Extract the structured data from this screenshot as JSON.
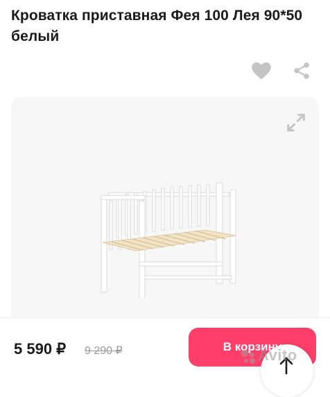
{
  "product": {
    "title": "Кроватка приставная Фея 100 Лея 90*50 белый"
  },
  "actions": {
    "favorite_icon": "heart-icon",
    "share_icon": "share-icon",
    "expand_icon": "expand-icon"
  },
  "purchase": {
    "price": "5 590 ₽",
    "old_price": "9 290 ₽",
    "cart_label": "В корзину"
  },
  "watermark": {
    "text": "Avito"
  },
  "colors": {
    "accent": "#ff3f6a",
    "icon_gray": "#c4c4c4",
    "gallery_bg": "#f7f7f7"
  }
}
